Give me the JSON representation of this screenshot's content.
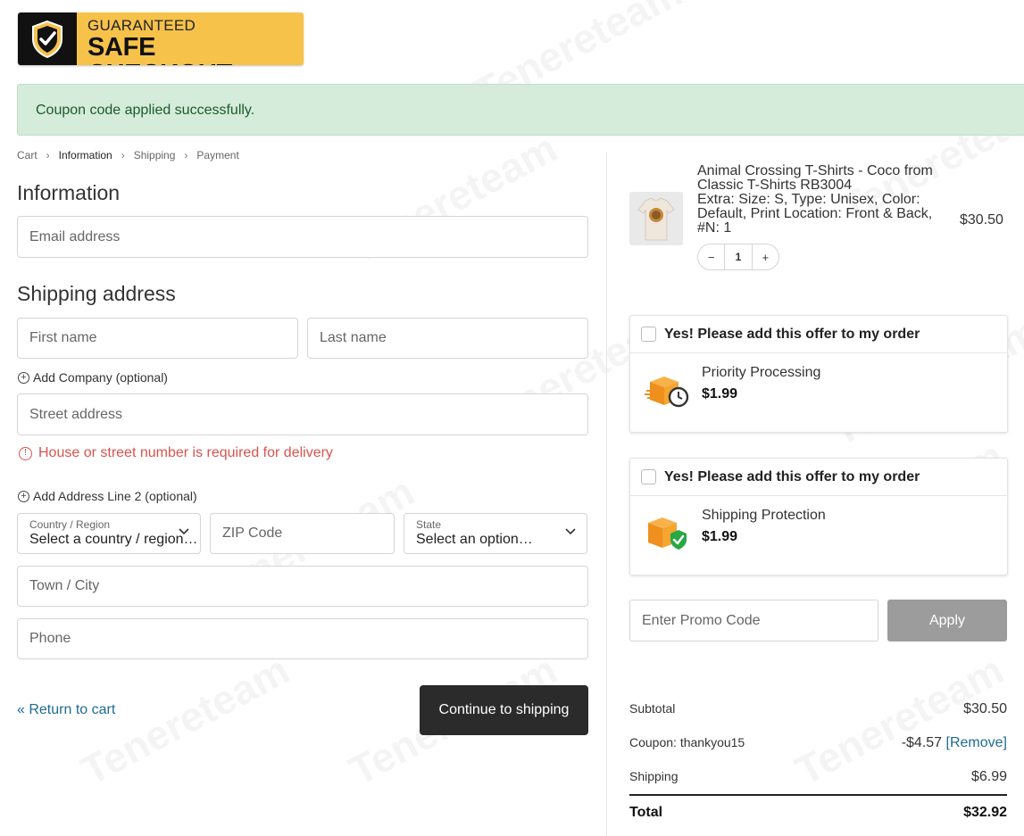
{
  "badge": {
    "line1": "GUARANTEED",
    "line2": "SAFE CHECKOUT"
  },
  "notice": {
    "text": "Coupon code applied successfully."
  },
  "breadcrumb": [
    "Cart",
    "Information",
    "Shipping",
    "Payment"
  ],
  "information": {
    "heading": "Information",
    "email_placeholder": "Email address"
  },
  "shipping": {
    "heading": "Shipping address",
    "first_name": "First name",
    "last_name": "Last name",
    "add_company": "Add Company (optional)",
    "street": "Street address",
    "street_error": "House or street number is required for delivery",
    "add_line2": "Add Address Line 2 (optional)",
    "country_label": "Country / Region",
    "country_value": "Select a country / region…",
    "zip": "ZIP Code",
    "state_label": "State",
    "state_value": "Select an option…",
    "city": "Town / City",
    "phone": "Phone"
  },
  "actions": {
    "return": "« Return to cart",
    "continue": "Continue to shipping"
  },
  "product": {
    "name": "Animal Crossing T-Shirts - Coco from Classic T-Shirts RB3004",
    "meta": "Extra: Size: S, Type: Unisex, Color: Default, Print Location: Front & Back, #N: 1",
    "price": "$30.50",
    "qty": "1",
    "minus": "−",
    "plus": "+"
  },
  "offers": [
    {
      "check_label": "Yes! Please add this offer to my order",
      "name": "Priority Processing",
      "price": "$1.99",
      "icon": "box-clock-icon"
    },
    {
      "check_label": "Yes! Please add this offer to my order",
      "name": "Shipping Protection",
      "price": "$1.99",
      "icon": "box-shield-icon"
    }
  ],
  "promo": {
    "placeholder": "Enter Promo Code",
    "apply": "Apply"
  },
  "totals": {
    "subtotal_label": "Subtotal",
    "subtotal": "$30.50",
    "coupon_label": "Coupon: thankyou15",
    "coupon": "-$4.57",
    "coupon_remove": "[Remove]",
    "shipping_label": "Shipping",
    "shipping": "$6.99",
    "total_label": "Total",
    "total": "$32.92"
  },
  "watermark": "Tenereteam",
  "colors": {
    "notice_bg": "#d4ecd9",
    "error": "#d9534f",
    "link": "#1f6b8f",
    "badge_yellow": "#f6c24a",
    "button_dark": "#2b2b2b"
  }
}
